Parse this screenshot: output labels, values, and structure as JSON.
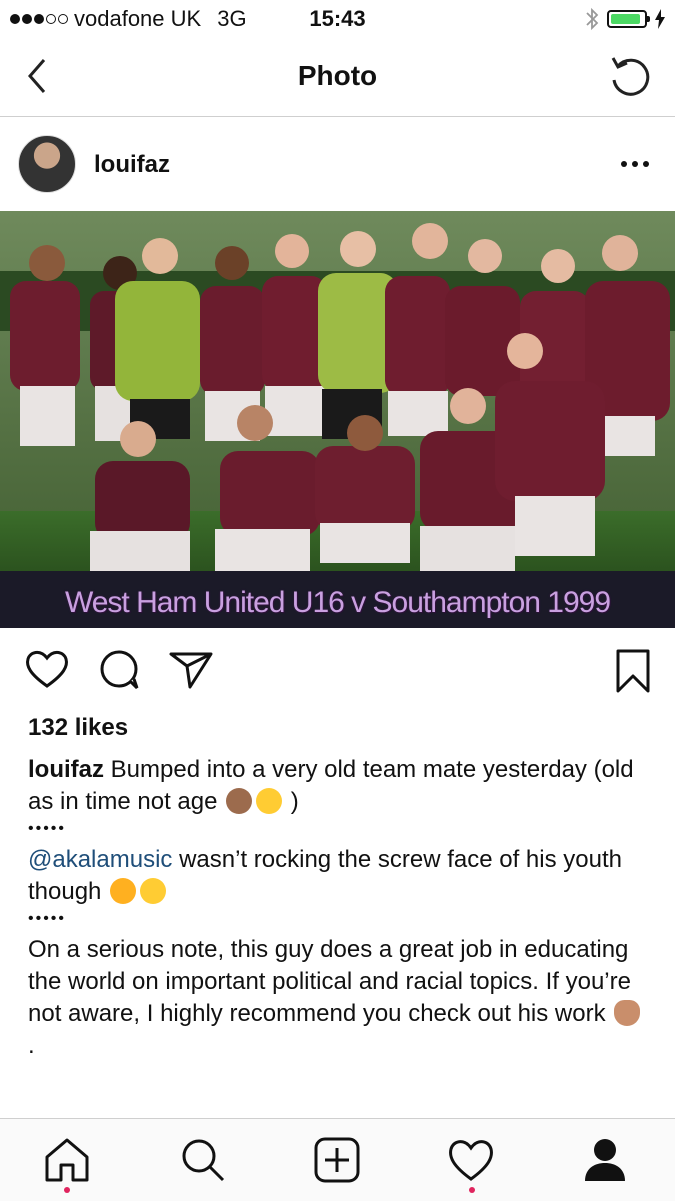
{
  "status": {
    "carrier": "vodafone UK",
    "network": "3G",
    "time": "15:43",
    "signal_total": 5,
    "signal_filled": 3,
    "battery_level": 0.9
  },
  "nav": {
    "title": "Photo"
  },
  "post": {
    "username": "louifaz",
    "photo_caption": "West Ham United U16 v Southampton 1999",
    "likes": "132 likes",
    "caption_user": "louifaz",
    "line1": "Bumped into a very old team mate yesterday (old as in time not age",
    "line1_end": ")",
    "separator": "•••••",
    "mention": "@akalamusic",
    "line2": "wasn’t rocking the screw face of his youth though",
    "line3": "On a serious note, this guy does a great job in educating the world on important political and racial topics. If you’re not aware, I highly recommend you check out his work",
    "trailing": "."
  },
  "colors": {
    "accent": "#e0245e",
    "mention": "#1f4e79",
    "battery": "#4cd964"
  },
  "icons": {
    "back": "chevron-left-icon",
    "refresh": "refresh-icon",
    "like": "heart-icon",
    "comment": "comment-icon",
    "share": "send-icon",
    "save": "bookmark-icon",
    "home": "home-icon",
    "search": "search-icon",
    "add": "add-icon",
    "activity": "heart-icon",
    "profile": "profile-icon"
  }
}
